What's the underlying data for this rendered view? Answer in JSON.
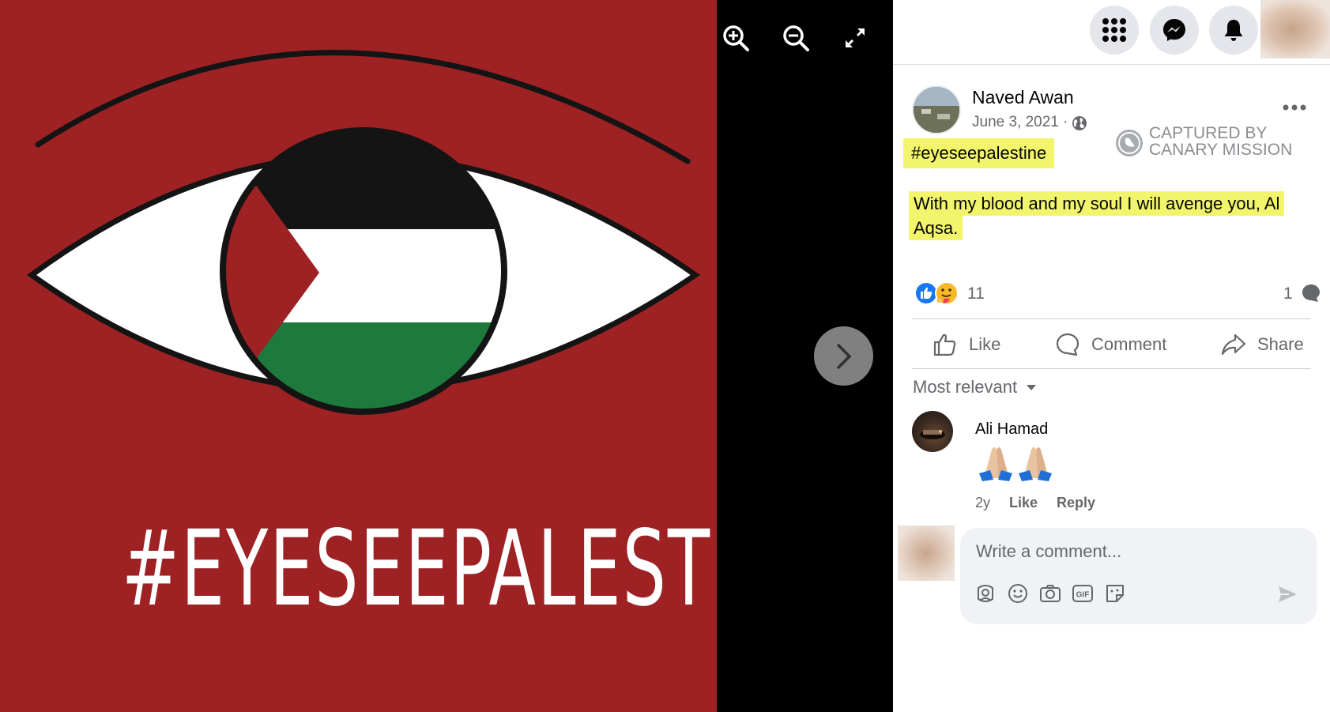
{
  "photo": {
    "caption": "#EYESEEPALESTINE",
    "colors": {
      "background": "#9e2224",
      "flag_black": "#141414",
      "flag_white": "#ffffff",
      "flag_green": "#1e7a3c",
      "flag_red": "#9e2224"
    }
  },
  "viewer": {
    "tools": [
      {
        "name": "zoom-in-icon"
      },
      {
        "name": "zoom-out-icon"
      },
      {
        "name": "fullscreen-icon"
      }
    ],
    "next_icon": "chevron-right-icon"
  },
  "topbar": {
    "icons": [
      "menu-grid-icon",
      "messenger-icon",
      "bell-icon"
    ]
  },
  "post": {
    "author": "Naved Awan",
    "date": "June 3, 2021 ·",
    "privacy_icon": "globe-icon",
    "hashtag": "#eyeseepalestine",
    "text": "With my blood and my soul I will avenge you, Al Aqsa.",
    "watermark": "CAPTURED BY CANARY MISSION",
    "reaction_count": "11",
    "comment_count": "1",
    "actions": {
      "like": "Like",
      "comment": "Comment",
      "share": "Share"
    },
    "colors": {
      "highlight": "#f2f56b",
      "like_blue": "#1877f2",
      "secondary_text": "#65676b"
    }
  },
  "comments": {
    "sort_label": "Most relevant",
    "items": [
      {
        "author": "Ali Hamad",
        "body": "🙏🏼🙏🏼",
        "time": "2y",
        "like": "Like",
        "reply": "Reply"
      }
    ]
  },
  "composer": {
    "placeholder": "Write a comment...",
    "icons": [
      "avatar-sticker-icon",
      "emoji-icon",
      "camera-icon",
      "gif-icon",
      "sticker-icon",
      "send-icon"
    ]
  }
}
